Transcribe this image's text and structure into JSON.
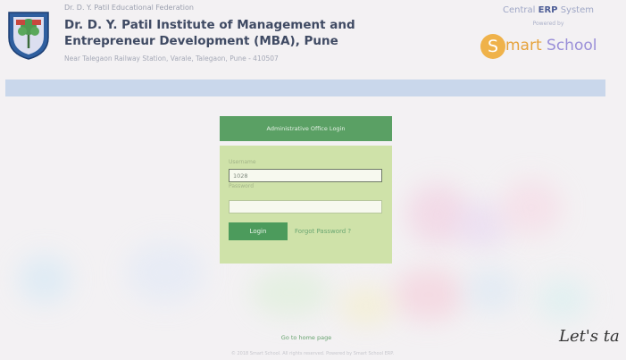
{
  "header": {
    "federation": "Dr. D. Y. Patil Educational Federation",
    "institute_name": "Dr. D. Y. Patil Institute of Management and Entrepreneur Development (MBA), Pune",
    "address": "Near Talegaon Railway Station, Varale, Talegaon, Pune - 410507",
    "logo_icon": "institute-crest-icon"
  },
  "erp": {
    "prefix": "Central",
    "bold": "ERP",
    "suffix": "System",
    "powered_by": "Powered by",
    "brand_letter": "S",
    "brand_rest": "mart ",
    "brand_school": "School"
  },
  "login": {
    "panel_title": "Administrative Office Login",
    "username_label": "Username",
    "username_value": "1028",
    "password_label": "Password",
    "password_value": "",
    "login_button": "Login",
    "forgot_link": "Forgot Password ?"
  },
  "footer": {
    "home_link": "Go to home page",
    "copyright": "© 2018 Smart School. All rights reserved. Powered by Smart School ERP.",
    "lets_text": "Let's ta"
  },
  "colors": {
    "panel_header": "#5aa064",
    "panel_body": "#cfe2a9",
    "login_button": "#4c9b5c",
    "blue_band": "#c9d7eb",
    "title_text": "#3f4a63"
  }
}
